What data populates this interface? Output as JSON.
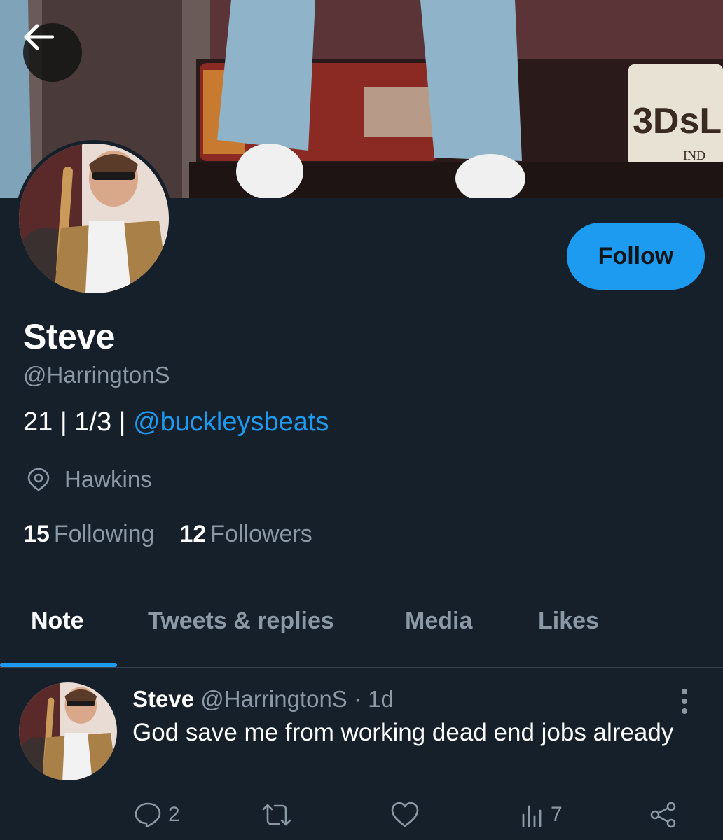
{
  "header": {
    "back_icon": "arrow-left-icon"
  },
  "profile": {
    "follow_label": "Follow",
    "name": "Steve",
    "handle": "@HarringtonS",
    "bio_prefix": "21 | 1/3 | ",
    "bio_mention": "@buckleysbeats",
    "location": "Hawkins",
    "following_count": "15",
    "following_label": "Following",
    "followers_count": "12",
    "followers_label": "Followers"
  },
  "tabs": [
    {
      "label": "Note"
    },
    {
      "label": "Tweets & replies"
    },
    {
      "label": "Media"
    },
    {
      "label": "Likes"
    }
  ],
  "tweet": {
    "author": "Steve",
    "meta": "@HarringtonS · 1d",
    "text": "God save me from working dead end jobs already",
    "replies": "2",
    "views": "7"
  },
  "banner_plate": {
    "plate_text": "3DsL",
    "plate_sub": "IND"
  },
  "colors": {
    "accent": "#1d9bf0",
    "background": "#15202b",
    "muted": "#8b98a5"
  }
}
